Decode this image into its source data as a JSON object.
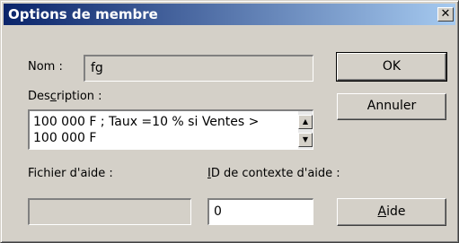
{
  "window": {
    "title": "Options de membre",
    "close_glyph": "✕"
  },
  "name": {
    "label": "Nom :",
    "value": "fg"
  },
  "description": {
    "label_pre": "Des",
    "label_u": "c",
    "label_post": "ription :",
    "lines": [
      "100 000 F ; Taux =10 % si Ventes >",
      "100 000 F"
    ]
  },
  "help_file": {
    "label": "Fichier d'aide :",
    "value": ""
  },
  "context_id": {
    "label_u": "I",
    "label_post": "D de contexte d'aide :",
    "value": "0"
  },
  "buttons": {
    "ok": "OK",
    "cancel": "Annuler",
    "help_u": "A",
    "help_post": "ide"
  },
  "icons": {
    "scroll_up": "scroll-up-icon",
    "scroll_down": "scroll-down-icon",
    "close": "close-icon"
  }
}
